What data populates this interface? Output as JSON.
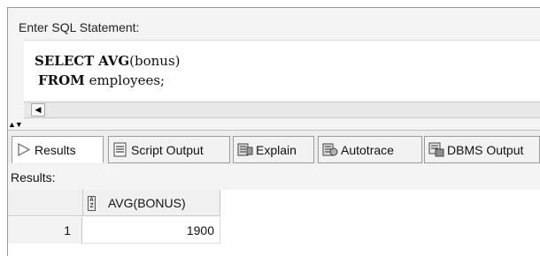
{
  "editor": {
    "prompt_label": "Enter SQL Statement:",
    "lines": [
      {
        "keyword": "SELECT",
        "keyword2": "AVG",
        "rest": "(bonus)"
      },
      {
        "keyword": "FROM",
        "rest": " employees;"
      }
    ]
  },
  "scroll": {
    "left_arrow": "◀"
  },
  "splitter": {
    "arrows": "▲▼"
  },
  "tabs": [
    {
      "label": "Results",
      "icon": "play-icon",
      "active": true
    },
    {
      "label": "Script Output",
      "icon": "script-icon"
    },
    {
      "label": "Explain",
      "icon": "explain-plan-icon"
    },
    {
      "label": "Autotrace",
      "icon": "autotrace-icon"
    },
    {
      "label": "DBMS Output",
      "icon": "dbms-output-icon"
    }
  ],
  "results": {
    "label": "Results:",
    "sort_icon_text": "A\nZ",
    "columns": [
      "AVG(BONUS)"
    ],
    "rows": [
      {
        "row_num": "1",
        "values": [
          "1900"
        ]
      }
    ]
  }
}
